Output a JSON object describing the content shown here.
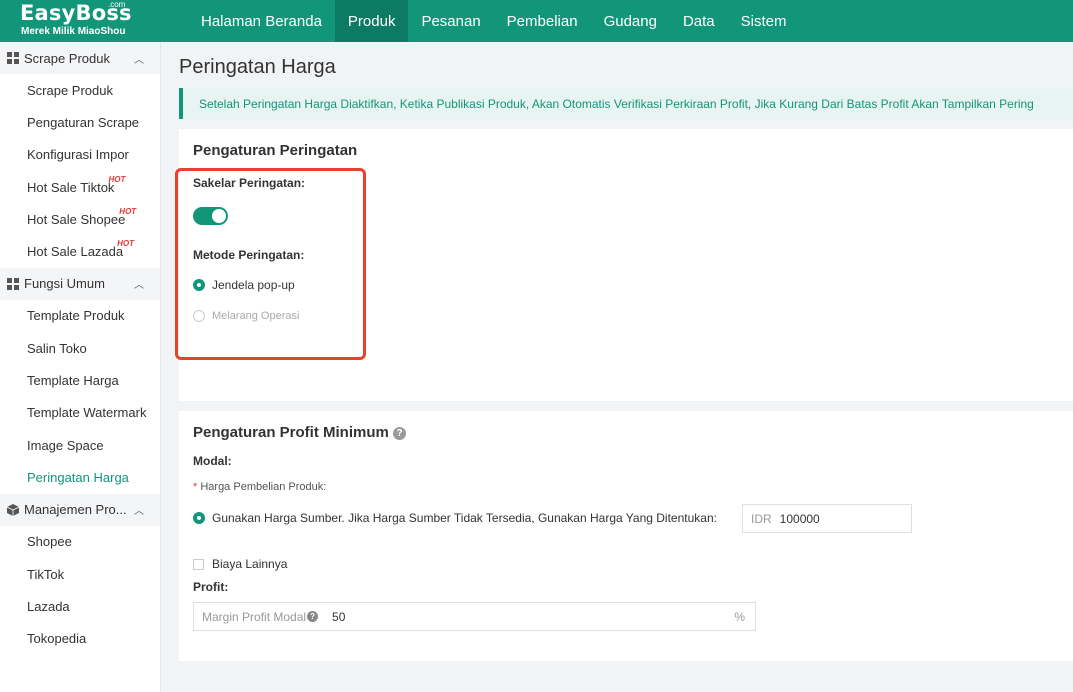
{
  "logo": {
    "brand": "EasyBoss",
    "dotcom": ".com",
    "tagline": "Merek Milik MiaoShou"
  },
  "nav": [
    "Halaman Beranda",
    "Produk",
    "Pesanan",
    "Pembelian",
    "Gudang",
    "Data",
    "Sistem"
  ],
  "sidebar": {
    "groups": [
      {
        "label": "Scrape Produk",
        "items": [
          {
            "label": "Scrape Produk"
          },
          {
            "label": "Pengaturan Scrape"
          },
          {
            "label": "Konfigurasi Impor"
          },
          {
            "label": "Hot Sale Tiktok",
            "badge": "HOT"
          },
          {
            "label": "Hot Sale Shopee",
            "badge": "HOT"
          },
          {
            "label": "Hot Sale Lazada",
            "badge": "HOT"
          }
        ]
      },
      {
        "label": "Fungsi Umum",
        "items": [
          {
            "label": "Template Produk"
          },
          {
            "label": "Salin Toko"
          },
          {
            "label": "Template Harga"
          },
          {
            "label": "Template Watermark"
          },
          {
            "label": "Image Space"
          },
          {
            "label": "Peringatan Harga"
          }
        ]
      },
      {
        "label": "Manajemen Pro...",
        "items": [
          {
            "label": "Shopee"
          },
          {
            "label": "TikTok"
          },
          {
            "label": "Lazada"
          },
          {
            "label": "Tokopedia"
          }
        ]
      }
    ]
  },
  "page": {
    "title": "Peringatan Harga",
    "notice": "Setelah Peringatan Harga Diaktifkan, Ketika Publikasi Produk, Akan Otomatis Verifikasi Perkiraan Profit, Jika Kurang Dari Batas Profit Akan Tampilkan Pering"
  },
  "warning": {
    "title": "Pengaturan Peringatan",
    "switch_label": "Sakelar Peringatan:",
    "switch_on": true,
    "method_label": "Metode Peringatan:",
    "option_popup": "Jendela pop-up",
    "option_block": "Melarang Operasi"
  },
  "profit": {
    "title": "Pengaturan Profit Minimum",
    "modal_label": "Modal:",
    "purchase_price_label": "Harga Pembelian Produk:",
    "source_price_option": "Gunakan Harga Sumber. Jika Harga Sumber Tidak Tersedia, Gunakan Harga Yang Ditentukan:",
    "currency": "IDR",
    "price_value": "100000",
    "other_costs": "Biaya Lainnya",
    "profit_label": "Profit:",
    "margin_placeholder": "Margin Profit Modal",
    "margin_value": "50",
    "margin_unit": "%"
  },
  "colors": {
    "brand": "#12967a",
    "highlight": "#e8412c",
    "hot": "#e53935"
  }
}
